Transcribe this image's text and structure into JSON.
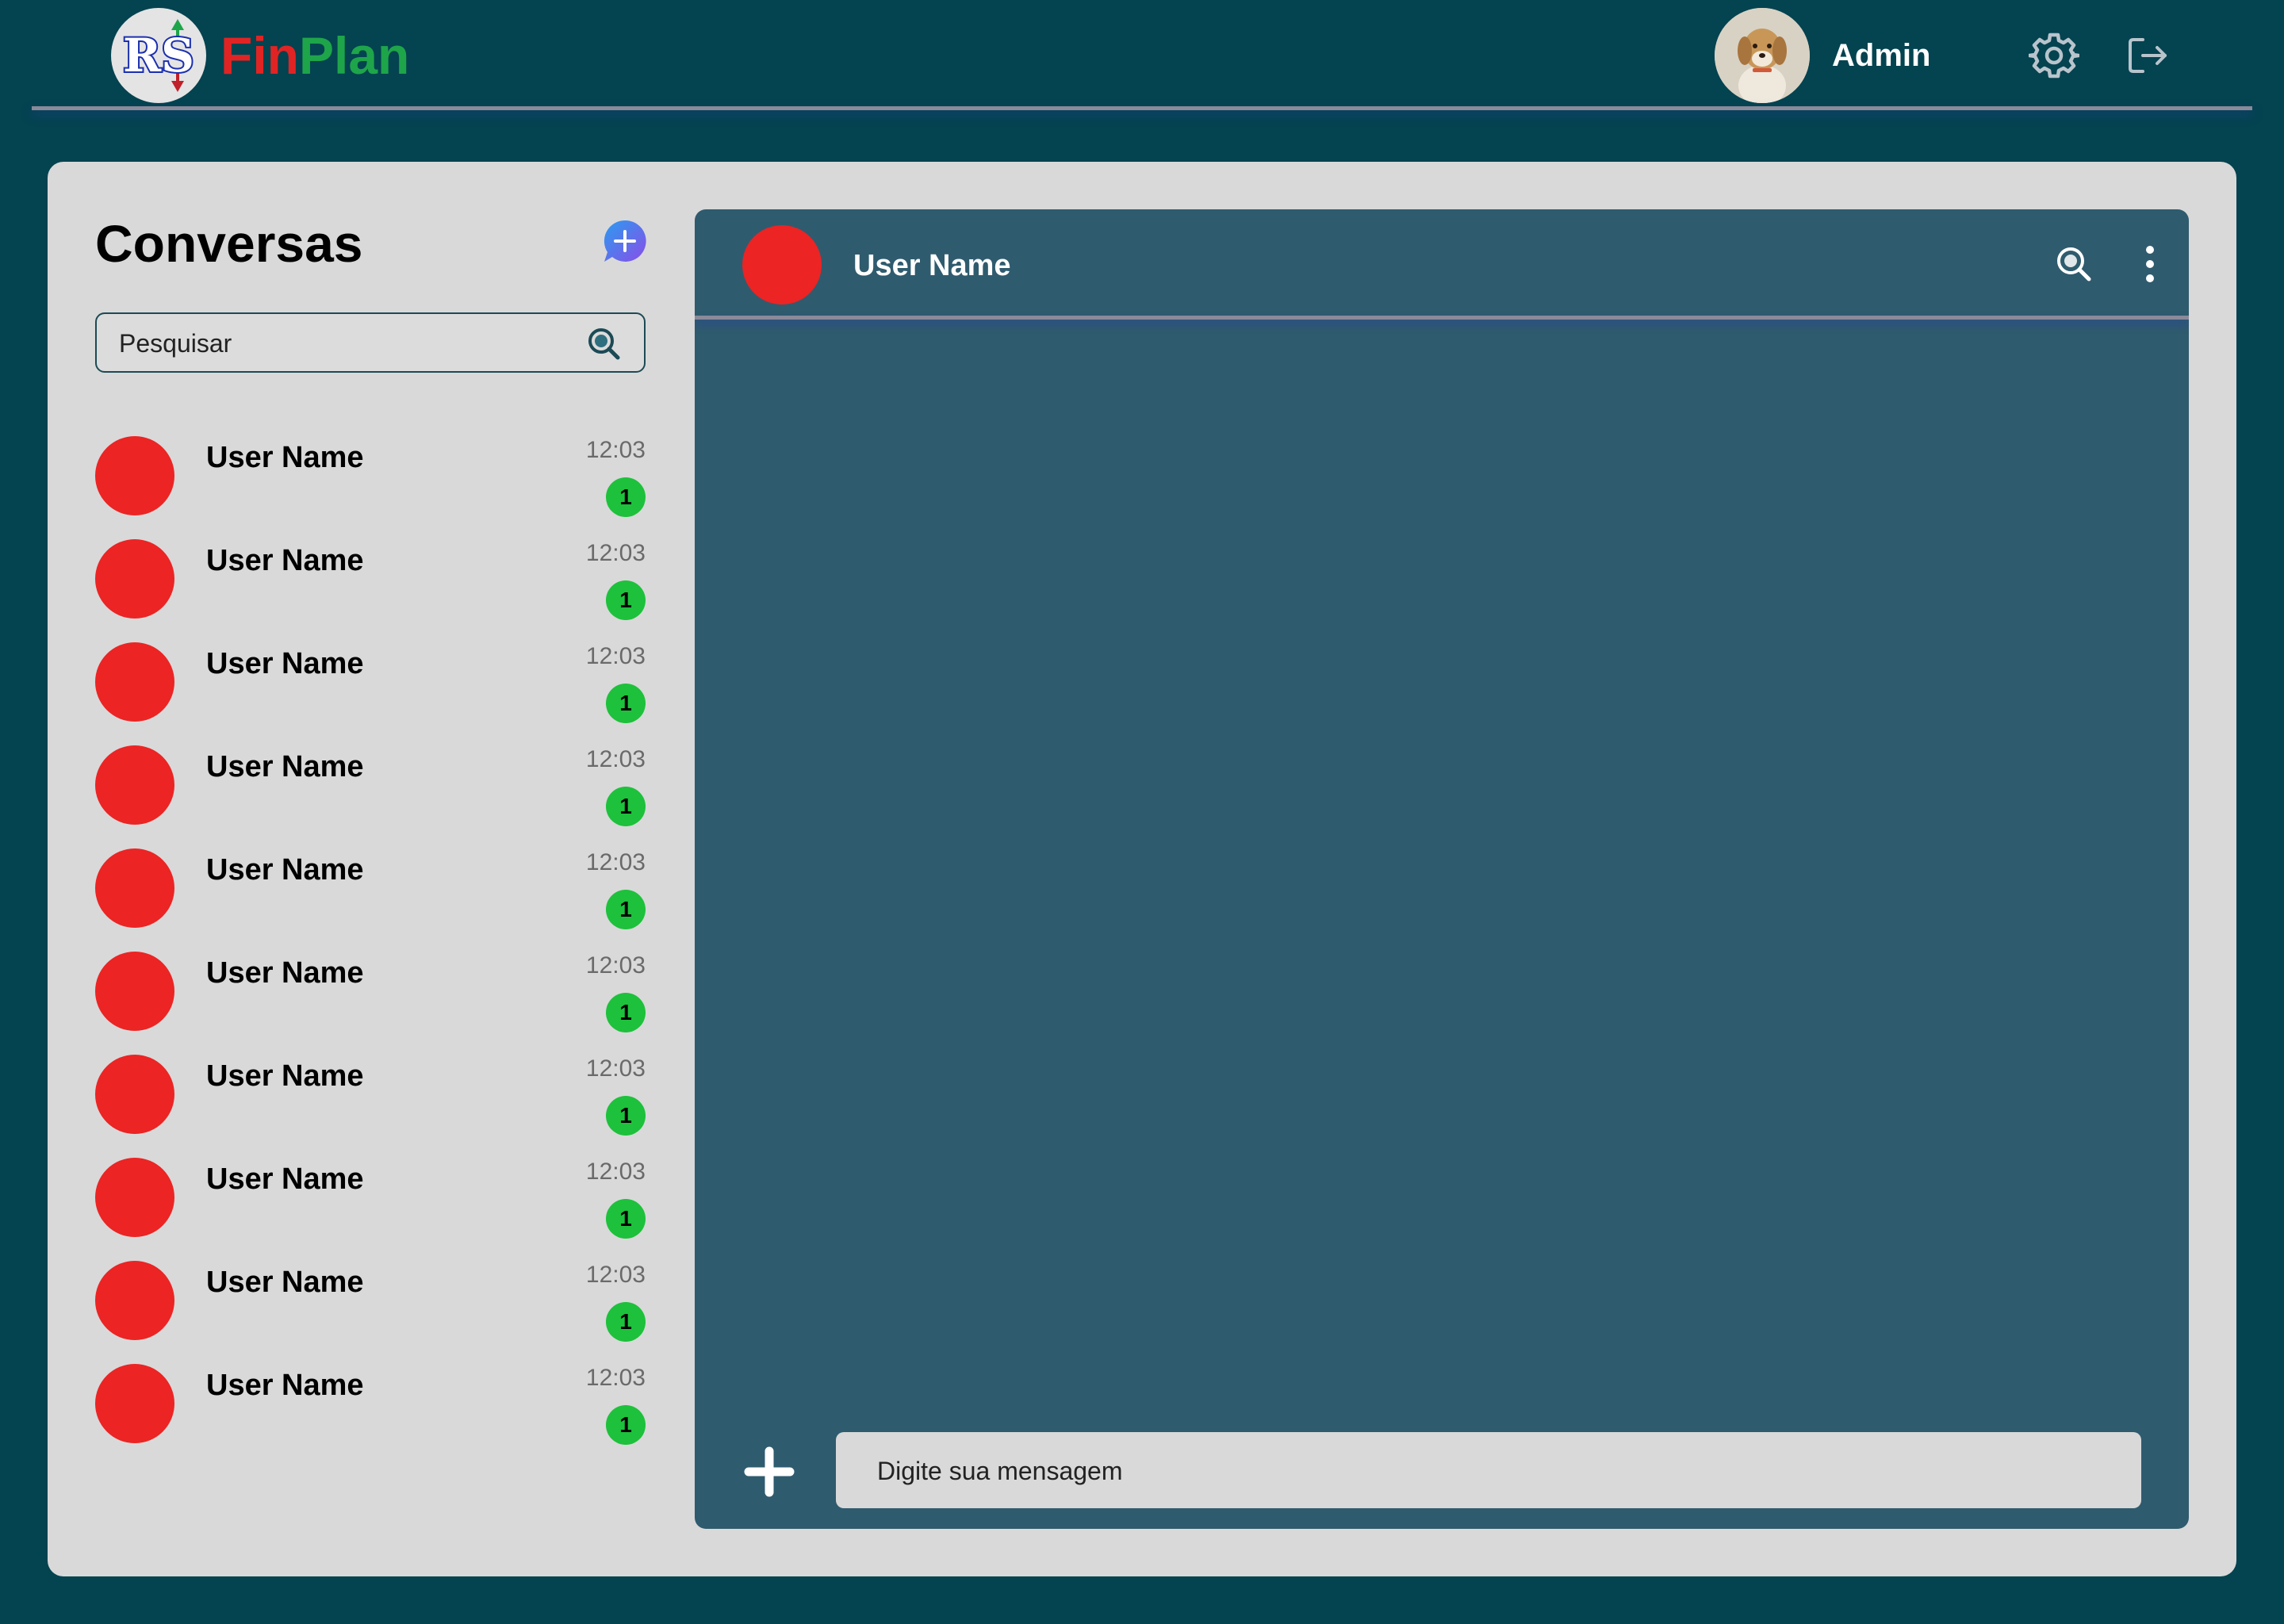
{
  "header": {
    "logo_mark_text": "RS",
    "brand_part1": "Fin",
    "brand_part2": "Plan",
    "user_name": "Admin",
    "icons": [
      "settings-gear-icon",
      "logout-icon"
    ]
  },
  "sidebar": {
    "title": "Conversas",
    "new_chat_icon": "chat-bubble-plus-icon",
    "search": {
      "placeholder": "Pesquisar",
      "value": ""
    },
    "conversations": [
      {
        "name": "User Name",
        "time": "12:03",
        "unread": "1"
      },
      {
        "name": "User Name",
        "time": "12:03",
        "unread": "1"
      },
      {
        "name": "User Name",
        "time": "12:03",
        "unread": "1"
      },
      {
        "name": "User Name",
        "time": "12:03",
        "unread": "1"
      },
      {
        "name": "User Name",
        "time": "12:03",
        "unread": "1"
      },
      {
        "name": "User Name",
        "time": "12:03",
        "unread": "1"
      },
      {
        "name": "User Name",
        "time": "12:03",
        "unread": "1"
      },
      {
        "name": "User Name",
        "time": "12:03",
        "unread": "1"
      },
      {
        "name": "User Name",
        "time": "12:03",
        "unread": "1"
      },
      {
        "name": "User Name",
        "time": "12:03",
        "unread": "1"
      }
    ]
  },
  "chat": {
    "contact_name": "User Name",
    "message_input": {
      "placeholder": "Digite sua mensagem",
      "value": ""
    },
    "icons": [
      "search-icon",
      "more-vertical-icon",
      "plus-icon"
    ]
  },
  "colors": {
    "page_background": "#044350",
    "panel_background": "#d9d9d9",
    "chat_background": "#2f5b6e",
    "avatar_placeholder": "#ec2424",
    "unread_badge": "#1dc13b",
    "brand_red": "#e02424",
    "brand_green": "#1ea54a"
  }
}
